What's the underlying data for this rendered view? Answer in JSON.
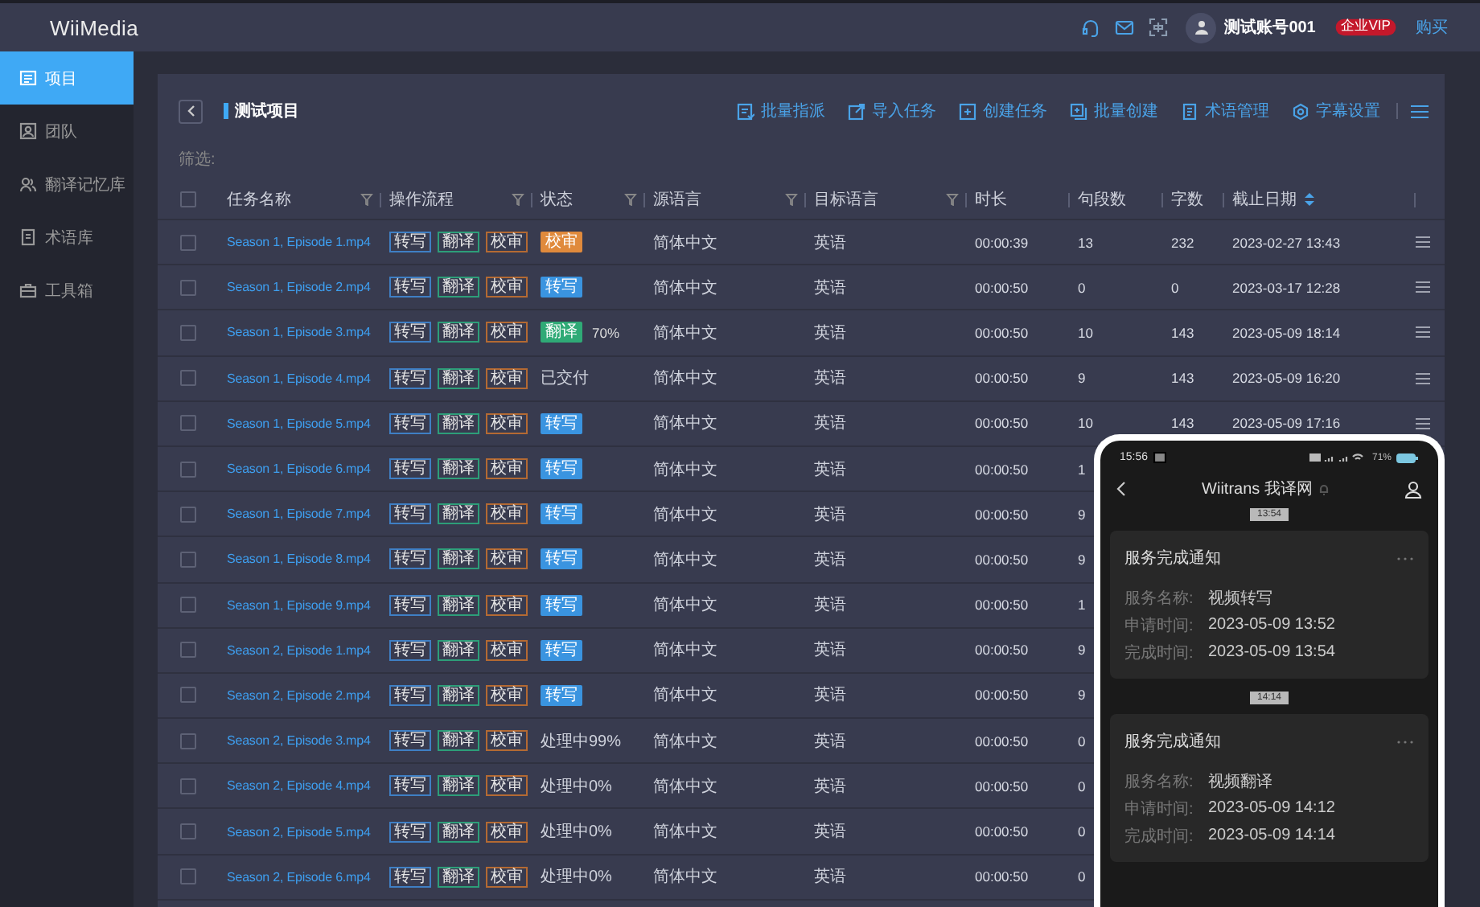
{
  "header": {
    "logo": "WiiMedia",
    "user": "测试账号001",
    "badge": "企业VIP",
    "buy_link": "购买"
  },
  "sidebar": {
    "items": [
      {
        "label": "项目",
        "selected": true
      },
      {
        "label": "团队",
        "selected": false
      },
      {
        "label": "翻译记忆库",
        "selected": false
      },
      {
        "label": "术语库",
        "selected": false
      },
      {
        "label": "工具箱",
        "selected": false
      }
    ]
  },
  "project": {
    "title": "测试项目",
    "actions": [
      "批量指派",
      "导入任务",
      "创建任务",
      "批量创建",
      "术语管理",
      "字幕设置"
    ],
    "filter_label": "筛选:"
  },
  "table": {
    "all_checked": false,
    "columns": [
      {
        "label": "任务名称",
        "filter": true,
        "sort": false
      },
      {
        "label": "操作流程",
        "filter": true,
        "sort": false
      },
      {
        "label": "状态",
        "filter": true,
        "sort": false
      },
      {
        "label": "源语言",
        "filter": true,
        "sort": false
      },
      {
        "label": "目标语言",
        "filter": true,
        "sort": false
      },
      {
        "label": "时长",
        "filter": false,
        "sort": false
      },
      {
        "label": "句段数",
        "filter": false,
        "sort": false
      },
      {
        "label": "字数",
        "filter": false,
        "sort": false
      },
      {
        "label": "截止日期",
        "filter": false,
        "sort": true
      }
    ],
    "rows": [
      {
        "checked": false,
        "name": "Season 1, Episode 1.mp4",
        "flow": [
          {
            "label": "转写",
            "kind": "transcribe"
          },
          {
            "label": "翻译",
            "kind": "translate"
          },
          {
            "label": "校审",
            "kind": "review"
          }
        ],
        "status": {
          "kind": "review",
          "label": "校审"
        },
        "source": "简体中文",
        "target": "英语",
        "duration": "00:00:39",
        "segments": "13",
        "words": "232",
        "deadline": "2023-02-27 13:43"
      },
      {
        "checked": false,
        "name": "Season 1, Episode 2.mp4",
        "flow": [
          {
            "label": "转写",
            "kind": "transcribe"
          },
          {
            "label": "翻译",
            "kind": "translate"
          },
          {
            "label": "校审",
            "kind": "review"
          }
        ],
        "status": {
          "kind": "transcribe",
          "label": "转写"
        },
        "source": "简体中文",
        "target": "英语",
        "duration": "00:00:50",
        "segments": "0",
        "words": "0",
        "deadline": "2023-03-17 12:28"
      },
      {
        "checked": false,
        "name": "Season 1, Episode 3.mp4",
        "flow": [
          {
            "label": "转写",
            "kind": "transcribe"
          },
          {
            "label": "翻译",
            "kind": "translate"
          },
          {
            "label": "校审",
            "kind": "review"
          }
        ],
        "status": {
          "kind": "translate",
          "label": "翻译",
          "note": "70%"
        },
        "source": "简体中文",
        "target": "英语",
        "duration": "00:00:50",
        "segments": "10",
        "words": "143",
        "deadline": "2023-05-09 18:14"
      },
      {
        "checked": false,
        "name": "Season 1, Episode 4.mp4",
        "flow": [
          {
            "label": "转写",
            "kind": "transcribe"
          },
          {
            "label": "翻译",
            "kind": "translate"
          },
          {
            "label": "校审",
            "kind": "review"
          }
        ],
        "status": {
          "kind": "text",
          "label": "已交付"
        },
        "source": "简体中文",
        "target": "英语",
        "duration": "00:00:50",
        "segments": "9",
        "words": "143",
        "deadline": "2023-05-09 16:20"
      },
      {
        "checked": false,
        "name": "Season 1, Episode 5.mp4",
        "flow": [
          {
            "label": "转写",
            "kind": "transcribe"
          },
          {
            "label": "翻译",
            "kind": "translate"
          },
          {
            "label": "校审",
            "kind": "review"
          }
        ],
        "status": {
          "kind": "transcribe",
          "label": "转写"
        },
        "source": "简体中文",
        "target": "英语",
        "duration": "00:00:50",
        "segments": "10",
        "words": "143",
        "deadline": "2023-05-09 17:16"
      },
      {
        "checked": false,
        "name": "Season 1, Episode 6.mp4",
        "flow": [
          {
            "label": "转写",
            "kind": "transcribe"
          },
          {
            "label": "翻译",
            "kind": "translate"
          },
          {
            "label": "校审",
            "kind": "review"
          }
        ],
        "status": {
          "kind": "transcribe",
          "label": "转写"
        },
        "source": "简体中文",
        "target": "英语",
        "duration": "00:00:50",
        "segments": "1"
      },
      {
        "checked": false,
        "name": "Season 1, Episode 7.mp4",
        "flow": [
          {
            "label": "转写",
            "kind": "transcribe"
          },
          {
            "label": "翻译",
            "kind": "translate"
          },
          {
            "label": "校审",
            "kind": "review"
          }
        ],
        "status": {
          "kind": "transcribe",
          "label": "转写"
        },
        "source": "简体中文",
        "target": "英语",
        "duration": "00:00:50",
        "segments": "9"
      },
      {
        "checked": false,
        "name": "Season 1, Episode 8.mp4",
        "flow": [
          {
            "label": "转写",
            "kind": "transcribe"
          },
          {
            "label": "翻译",
            "kind": "translate"
          },
          {
            "label": "校审",
            "kind": "review"
          }
        ],
        "status": {
          "kind": "transcribe",
          "label": "转写"
        },
        "source": "简体中文",
        "target": "英语",
        "duration": "00:00:50",
        "segments": "9"
      },
      {
        "checked": false,
        "name": "Season 1, Episode 9.mp4",
        "flow": [
          {
            "label": "转写",
            "kind": "transcribe"
          },
          {
            "label": "翻译",
            "kind": "translate"
          },
          {
            "label": "校审",
            "kind": "review"
          }
        ],
        "status": {
          "kind": "transcribe",
          "label": "转写"
        },
        "source": "简体中文",
        "target": "英语",
        "duration": "00:00:50",
        "segments": "1"
      },
      {
        "checked": false,
        "name": "Season 2, Episode 1.mp4",
        "flow": [
          {
            "label": "转写",
            "kind": "transcribe"
          },
          {
            "label": "翻译",
            "kind": "translate"
          },
          {
            "label": "校审",
            "kind": "review"
          }
        ],
        "status": {
          "kind": "transcribe",
          "label": "转写"
        },
        "source": "简体中文",
        "target": "英语",
        "duration": "00:00:50",
        "segments": "9"
      },
      {
        "checked": false,
        "name": "Season 2, Episode 2.mp4",
        "flow": [
          {
            "label": "转写",
            "kind": "transcribe"
          },
          {
            "label": "翻译",
            "kind": "translate"
          },
          {
            "label": "校审",
            "kind": "review"
          }
        ],
        "status": {
          "kind": "transcribe",
          "label": "转写"
        },
        "source": "简体中文",
        "target": "英语",
        "duration": "00:00:50",
        "segments": "9"
      },
      {
        "checked": false,
        "name": "Season 2, Episode 3.mp4",
        "flow": [
          {
            "label": "转写",
            "kind": "transcribe"
          },
          {
            "label": "翻译",
            "kind": "translate"
          },
          {
            "label": "校审",
            "kind": "review"
          }
        ],
        "status": {
          "kind": "text",
          "label": "处理中99%"
        },
        "source": "简体中文",
        "target": "英语",
        "duration": "00:00:50",
        "segments": "0"
      },
      {
        "checked": false,
        "name": "Season 2, Episode 4.mp4",
        "flow": [
          {
            "label": "转写",
            "kind": "transcribe"
          },
          {
            "label": "翻译",
            "kind": "translate"
          },
          {
            "label": "校审",
            "kind": "review"
          }
        ],
        "status": {
          "kind": "text",
          "label": "处理中0%"
        },
        "source": "简体中文",
        "target": "英语",
        "duration": "00:00:50",
        "segments": "0"
      },
      {
        "checked": false,
        "name": "Season 2, Episode 5.mp4",
        "flow": [
          {
            "label": "转写",
            "kind": "transcribe"
          },
          {
            "label": "翻译",
            "kind": "translate"
          },
          {
            "label": "校审",
            "kind": "review"
          }
        ],
        "status": {
          "kind": "text",
          "label": "处理中0%"
        },
        "source": "简体中文",
        "target": "英语",
        "duration": "00:00:50",
        "segments": "0"
      },
      {
        "checked": false,
        "name": "Season 2, Episode 6.mp4",
        "flow": [
          {
            "label": "转写",
            "kind": "transcribe"
          },
          {
            "label": "翻译",
            "kind": "translate"
          },
          {
            "label": "校审",
            "kind": "review"
          }
        ],
        "status": {
          "kind": "text",
          "label": "处理中0%"
        },
        "source": "简体中文",
        "target": "英语",
        "duration": "00:00:50",
        "segments": "0"
      }
    ]
  },
  "phone": {
    "status_bar": {
      "time": "15:56",
      "battery": "71%"
    },
    "title": "Wiitrans 我译网",
    "messages": [
      {
        "time": "13:54",
        "title": "服务完成通知",
        "fields": [
          {
            "label": "服务名称:",
            "value": "视频转写"
          },
          {
            "label": "申请时间:",
            "value": "2023-05-09 13:52"
          },
          {
            "label": "完成时间:",
            "value": "2023-05-09 13:54"
          }
        ]
      },
      {
        "time": "14:14",
        "title": "服务完成通知",
        "fields": [
          {
            "label": "服务名称:",
            "value": "视频翻译"
          },
          {
            "label": "申请时间:",
            "value": "2023-05-09 14:12"
          },
          {
            "label": "完成时间:",
            "value": "2023-05-09 14:14"
          }
        ]
      }
    ]
  }
}
